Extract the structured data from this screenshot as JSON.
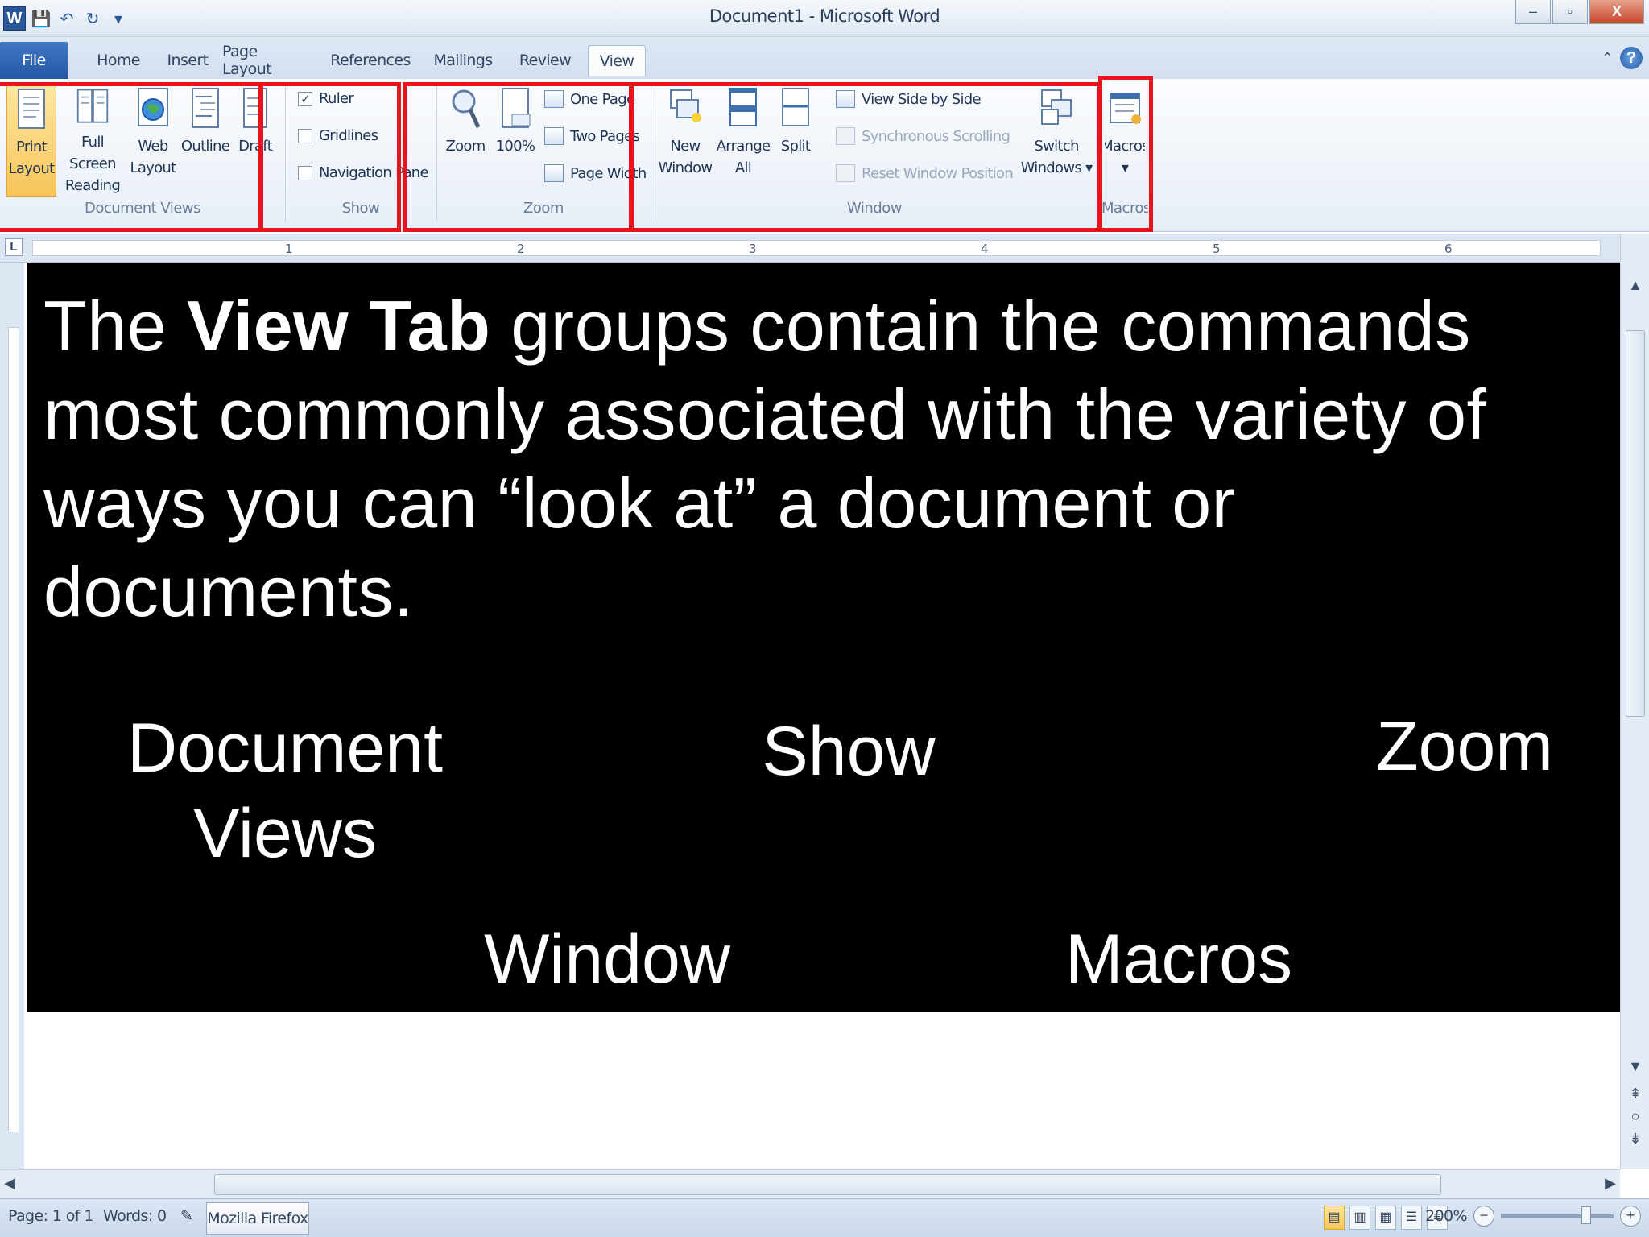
{
  "window": {
    "title": "Document1 - Microsoft Word",
    "app_icon": "W",
    "minimize": "–",
    "restore": "▫",
    "close": "X"
  },
  "qat": {
    "save_icon": "💾",
    "undo_icon": "↶",
    "redo_icon": "↻",
    "customize_icon": "▾"
  },
  "tabs": [
    {
      "label": "File"
    },
    {
      "label": "Home"
    },
    {
      "label": "Insert"
    },
    {
      "label": "Page Layout"
    },
    {
      "label": "References"
    },
    {
      "label": "Mailings"
    },
    {
      "label": "Review"
    },
    {
      "label": "View"
    }
  ],
  "help": {
    "minimize_ribbon": "⌃",
    "help": "?"
  },
  "ribbon": {
    "document_views": {
      "label": "Document Views",
      "buttons": [
        {
          "line1": "Print",
          "line2": "Layout"
        },
        {
          "line1": "Full Screen",
          "line2": "Reading"
        },
        {
          "line1": "Web",
          "line2": "Layout"
        },
        {
          "line1": "Outline",
          "line2": ""
        },
        {
          "line1": "Draft",
          "line2": ""
        }
      ]
    },
    "show": {
      "label": "Show",
      "items": [
        {
          "label": "Ruler",
          "checked": "✓"
        },
        {
          "label": "Gridlines",
          "checked": ""
        },
        {
          "label": "Navigation Pane",
          "checked": ""
        }
      ]
    },
    "zoom": {
      "label": "Zoom",
      "buttons": [
        {
          "label": "Zoom"
        },
        {
          "label": "100%"
        }
      ],
      "small": [
        {
          "label": "One Page"
        },
        {
          "label": "Two Pages"
        },
        {
          "label": "Page Width"
        }
      ]
    },
    "window": {
      "label": "Window",
      "buttons": [
        {
          "line1": "New",
          "line2": "Window"
        },
        {
          "line1": "Arrange",
          "line2": "All"
        },
        {
          "line1": "Split",
          "line2": ""
        }
      ],
      "small": [
        {
          "label": "View Side by Side"
        },
        {
          "label": "Synchronous Scrolling"
        },
        {
          "label": "Reset Window Position"
        }
      ],
      "switch": {
        "line1": "Switch",
        "line2": "Windows ▾"
      }
    },
    "macros": {
      "label": "Macros",
      "button": {
        "line1": "Macros",
        "line2": "▾"
      }
    }
  },
  "ruler": {
    "corner": "L",
    "numbers": [
      "1",
      "2",
      "3",
      "4",
      "5",
      "6"
    ]
  },
  "slide": {
    "headline_pre": "The ",
    "headline_bold": "View Tab",
    "headline_post": " groups contain the commands most commonly associated with the variety of ways you can “look at” a document or documents.",
    "labels": {
      "document_views_1": "Document",
      "document_views_2": "Views",
      "show": "Show",
      "zoom": "Zoom",
      "window": "Window",
      "macros": "Macros"
    }
  },
  "status": {
    "page": "Page: 1 of 1",
    "words": "Words: 0",
    "proofing_icon": "✎",
    "taskbar": "Mozilla Firefox",
    "zoom": "200%",
    "zoom_out": "−",
    "zoom_in": "+"
  }
}
